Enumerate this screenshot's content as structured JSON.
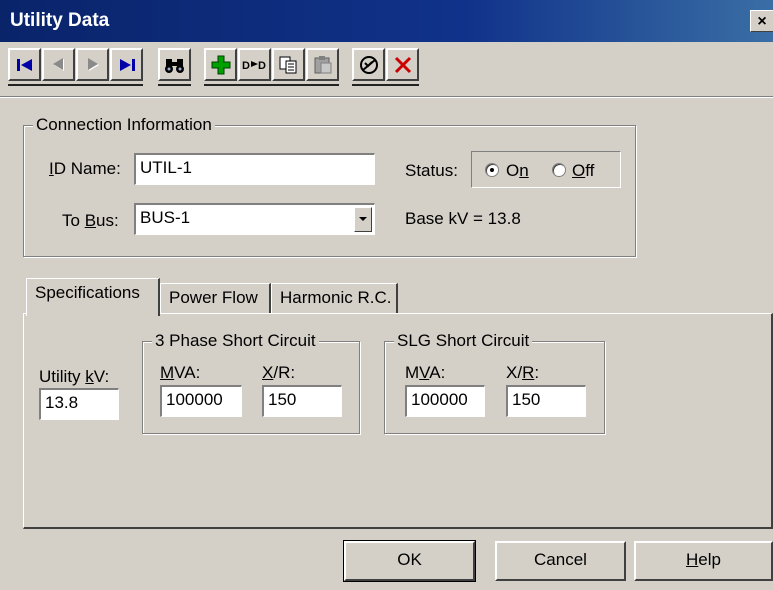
{
  "window": {
    "title": "Utility Data",
    "close_label": "×"
  },
  "toolbar": {
    "icons": [
      "first-record-icon",
      "previous-record-icon",
      "next-record-icon",
      "last-record-icon",
      "find-binoculars-icon",
      "add-icon",
      "insert-icon",
      "copy-icon",
      "paste-icon",
      "undo-icon",
      "delete-icon"
    ]
  },
  "connection": {
    "group_label": "Connection Information",
    "id_label": "ID Name:",
    "id_value": "UTIL-1",
    "status_label": "Status:",
    "on_label": "On",
    "off_label": "Off",
    "status_selected": "On",
    "to_bus_label": "To Bus:",
    "to_bus_value": "BUS-1",
    "base_kv": "Base kV =  13.8"
  },
  "tabs": [
    {
      "label": "Specifications",
      "active": true
    },
    {
      "label": "Power Flow",
      "active": false
    },
    {
      "label": "Harmonic R.C.",
      "active": false
    }
  ],
  "specs": {
    "utility_kv_label": "Utility kV:",
    "utility_kv_value": "13.8",
    "three_phase": {
      "label": "3 Phase Short Circuit",
      "mva_label": "MVA:",
      "mva_value": "100000",
      "xr_label": "X/R:",
      "xr_value": "150"
    },
    "slg": {
      "label": "SLG Short Circuit",
      "mva_label": "MVA:",
      "mva_value": "100000",
      "xr_label": "X/R:",
      "xr_value": "150"
    }
  },
  "buttons": {
    "ok": "OK",
    "cancel": "Cancel",
    "help": "Help"
  },
  "colors": {
    "titlebar": "#0a246a",
    "face": "#d4d0c8",
    "add_green": "#00a000",
    "delete_red": "#cc0000",
    "nav_blue": "#0000a8"
  }
}
